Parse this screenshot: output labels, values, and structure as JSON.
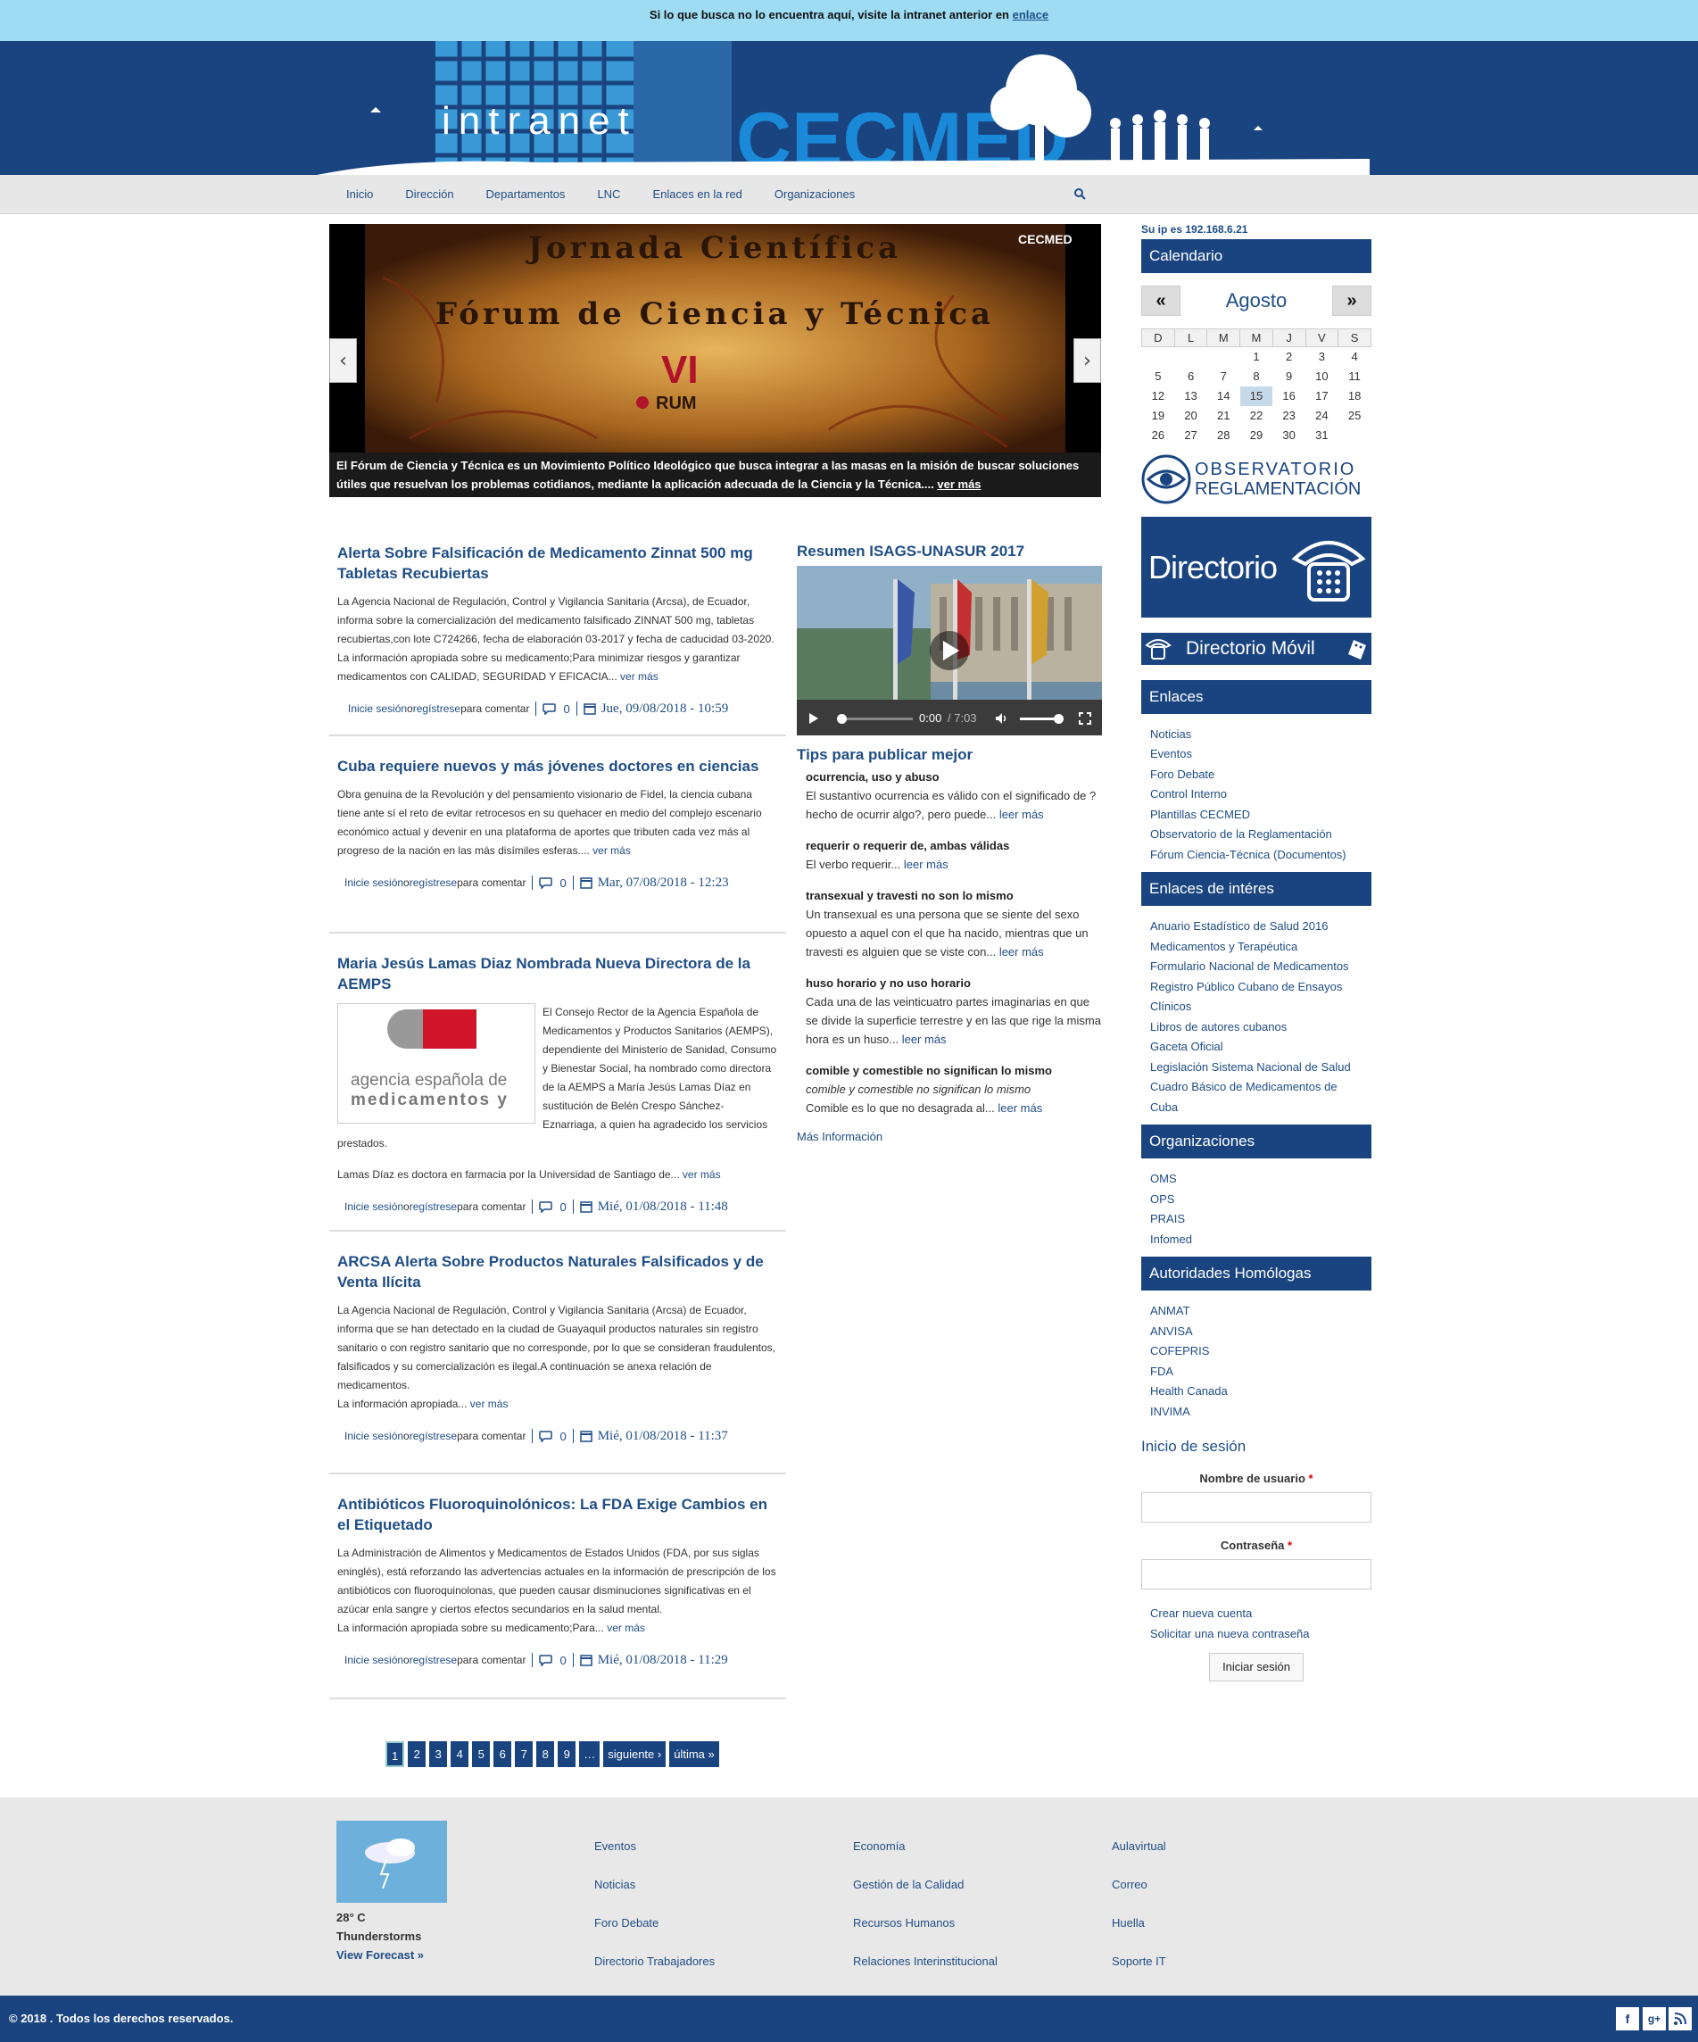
{
  "topbar": {
    "text": "Si lo que busca no lo encuentra aquí, visite la intranet anterior en ",
    "link": "enlace"
  },
  "header": {
    "logo_left": "intranet",
    "logo_right": "CECMED"
  },
  "nav": {
    "items": [
      "Inicio",
      "Dirección",
      "Departamentos",
      "LNC",
      "Enlaces en la red",
      "Organizaciones"
    ]
  },
  "slider": {
    "title1": "Jornada Científica",
    "title2": "Fórum de Ciencia y Técnica",
    "badge": "CECMED",
    "forum_mark": "VI",
    "forum_word": "RUM",
    "caption": "El Fórum de Ciencia y Técnica es un Movimiento Político Ideológico que busca integrar a las masas en la misión de buscar soluciones útiles que resuelvan los problemas cotidianos,  mediante la aplicación adecuada de la Ciencia y la Técnica....",
    "more": "ver más"
  },
  "articles": [
    {
      "title": "Alerta Sobre Falsificación de Medicamento Zinnat 500 mg Tabletas Recubiertas",
      "body": "La Agencia Nacional de Regulación, Control y Vigilancia Sanitaria (Arcsa), de Ecuador, informa sobre la comercialización del medicamento falsificado ZINNAT 500 mg, tabletas recubiertas,con lote C724266, fecha de elaboración 03-2017 y fecha de caducidad 03-2020.",
      "body2": "La información apropiada sobre su medicamento;Para minimizar riesgos y garantizar medicamentos con CALIDAD, SEGURIDAD Y EFICACIA...",
      "more": "ver más",
      "comments": "0",
      "date": "Jue, 09/08/2018 - 10:59"
    },
    {
      "title": "Cuba requiere nuevos y más jóvenes doctores en ciencias",
      "body": "Obra genuina de la Revolución y del pensamiento visionario de Fidel, la ciencia cubana tiene ante sí el reto de evitar retrocesos en su quehacer en medio del complejo escenario económico actual y devenir en una plataforma de aportes que tributen cada vez más al progreso de la nación en las más disímiles esferas....",
      "body2": "",
      "more": "ver más",
      "comments": "0",
      "date": "Mar, 07/08/2018 - 12:23"
    },
    {
      "title": "Maria Jesús Lamas Diaz Nombrada Nueva Directora de la AEMPS",
      "body": "El Consejo Rector de la Agencia Española de Medicamentos y Productos Sanitarios (AEMPS), dependiente del Ministerio de Sanidad, Consumo y Bienestar Social, ha nombrado como directora de la AEMPS a María Jesús Lamas Díaz en sustitución de Belén Crespo Sánchez-Eznarriaga, a quien ha agradecido los servicios prestados.",
      "body2": "Lamas Díaz es doctora en farmacia por la Universidad de Santiago de...",
      "more": "ver más",
      "comments": "0",
      "date": "Mié, 01/08/2018 - 11:48",
      "image_text1": "agencia española de",
      "image_text2": "medicamentos y"
    },
    {
      "title": "ARCSA Alerta Sobre Productos Naturales Falsificados y de Venta Ilícita",
      "body": "La Agencia Nacional de Regulación, Control y Vigilancia Sanitaria (Arcsa) de Ecuador, informa que se han detectado en la ciudad de Guayaquil productos naturales sin registro sanitario o con registro sanitario que no corresponde, por lo que se consideran fraudulentos, falsificados y su comercialización es ilegal.A continuación se anexa relación de medicamentos.",
      "body2": "La información apropiada...",
      "more": "ver más",
      "comments": "0",
      "date": "Mié, 01/08/2018 - 11:37"
    },
    {
      "title": "Antibióticos Fluoroquinolónicos: La FDA Exige Cambios en el Etiquetado",
      "body": "La Administración de Alimentos y Medicamentos de Estados Unidos (FDA, por sus siglas eninglés), está reforzando las advertencias actuales en la información de prescripción de los antibióticos con fluoroquinolonas, que pueden causar disminuciones significativas en el azúcar enla sangre y ciertos efectos secundarios en la salud mental.",
      "body2": "La información apropiada sobre su medicamento;Para...",
      "more": "ver más",
      "comments": "0",
      "date": "Mié, 01/08/2018 - 11:29"
    }
  ],
  "comment_prompt": {
    "login": "Inicie sesión",
    "or": " o ",
    "register": "regístrese",
    "rest": " para comentar"
  },
  "pager": {
    "pages": [
      "1",
      "2",
      "3",
      "4",
      "5",
      "6",
      "7",
      "8",
      "9",
      "…"
    ],
    "next": "siguiente ›",
    "last": "última »"
  },
  "video": {
    "title": "Resumen ISAGS-UNASUR 2017",
    "time": "0:00",
    "duration": "/ 7:03"
  },
  "tips": {
    "title": "Tips para publicar mejor",
    "items": [
      {
        "head": "ocurrencia, uso y abuso",
        "text": "El sustantivo ocurrencia es válido con el significado de ?hecho de ocurrir algo?, pero puede...",
        "more": "leer más"
      },
      {
        "head": "requerir o requerir de, ambas válidas",
        "text": "El verbo requerir...",
        "more": "leer más"
      },
      {
        "head": "transexual y travesti no son lo mismo",
        "text": "Un transexual es una persona que se siente del sexo opuesto a aquel con el que ha nacido, mientras que un travesti es alguien que se viste con...",
        "more": "leer más"
      },
      {
        "head": "huso horario y no uso horario",
        "text": "Cada una de las veinticuatro partes imaginarias en que se divide la superficie terrestre y en las que rige la misma hora es un huso...",
        "more": "leer más"
      },
      {
        "head": "comible y comestible no significan lo mismo",
        "text": "comible y comestible no significan lo mismo",
        "text2": "Comible es lo que no desagrada al...",
        "more": "leer más"
      }
    ],
    "more_info": "Más Información"
  },
  "sidebar": {
    "ip": "Su ip es 192.168.6.21",
    "calendar_title": "Calendario",
    "month": "Agosto",
    "prev": "«",
    "next": "»",
    "weekdays": [
      "D",
      "L",
      "M",
      "M",
      "J",
      "V",
      "S"
    ],
    "weeks": [
      [
        "",
        "",
        "",
        "1",
        "2",
        "3",
        "4"
      ],
      [
        "5",
        "6",
        "7",
        "8",
        "9",
        "10",
        "11"
      ],
      [
        "12",
        "13",
        "14",
        "15",
        "16",
        "17",
        "18"
      ],
      [
        "19",
        "20",
        "21",
        "22",
        "23",
        "24",
        "25"
      ],
      [
        "26",
        "27",
        "28",
        "29",
        "30",
        "31",
        ""
      ]
    ],
    "today": "15",
    "observatorio1": "OBSERVATORIO",
    "observatorio2": "REGLAMENTACIÓN",
    "directorio": "Directorio",
    "directorio_movil": "Directorio Móvil",
    "enlaces_title": "Enlaces",
    "enlaces": [
      "Noticias",
      "Eventos",
      "Foro Debate",
      "Control Interno",
      "Plantillas CECMED",
      "Observatorio de la Reglamentación",
      "Fórum Ciencia-Técnica (Documentos)"
    ],
    "interes_title": "Enlaces de intéres",
    "interes": [
      "Anuario Estadístico de Salud 2016",
      "Medicamentos y Terapéutica",
      "Formulario Nacional de Medicamentos",
      "Registro Público Cubano de Ensayos",
      "Clínicos",
      "Libros de autores cubanos",
      "Gaceta Oficial",
      "Legislación Sistema Nacional de Salud",
      "Cuadro Básico de Medicamentos de",
      "Cuba"
    ],
    "org_title": "Organizaciones",
    "orgs": [
      "OMS",
      "OPS",
      "PRAIS",
      "Infomed"
    ],
    "aut_title": "Autoridades Homólogas",
    "auts": [
      "ANMAT",
      "ANVISA",
      "COFEPRIS",
      "FDA",
      "Health Canada",
      "INVIMA"
    ],
    "login_title": "Inicio de sesión",
    "user_label": "Nombre de usuario",
    "pass_label": "Contraseña",
    "required": "*",
    "create": "Crear nueva cuenta",
    "reset": "Solicitar una nueva contraseña",
    "submit": "Iniciar sesión"
  },
  "footer": {
    "temp": "28° C",
    "cond": "Thunderstorms",
    "forecast": "View Forecast »",
    "col1": [
      "Eventos",
      "Noticias",
      "Foro Debate",
      "Directorio Trabajadores"
    ],
    "col2": [
      "Economía",
      "Gestión de la Calidad",
      "Recursos Humanos",
      "Relaciones Interinstitucional"
    ],
    "col3": [
      "Aulavirtual",
      "Correo",
      "Huella",
      "Soporte IT"
    ],
    "copyright": "© 2018 . Todos los derechos reservados.",
    "social": [
      "f",
      "g+",
      "rss"
    ]
  },
  "colors": {
    "brand": "#1a4480",
    "topbar": "#9edcf4",
    "link": "#1f4d86"
  }
}
